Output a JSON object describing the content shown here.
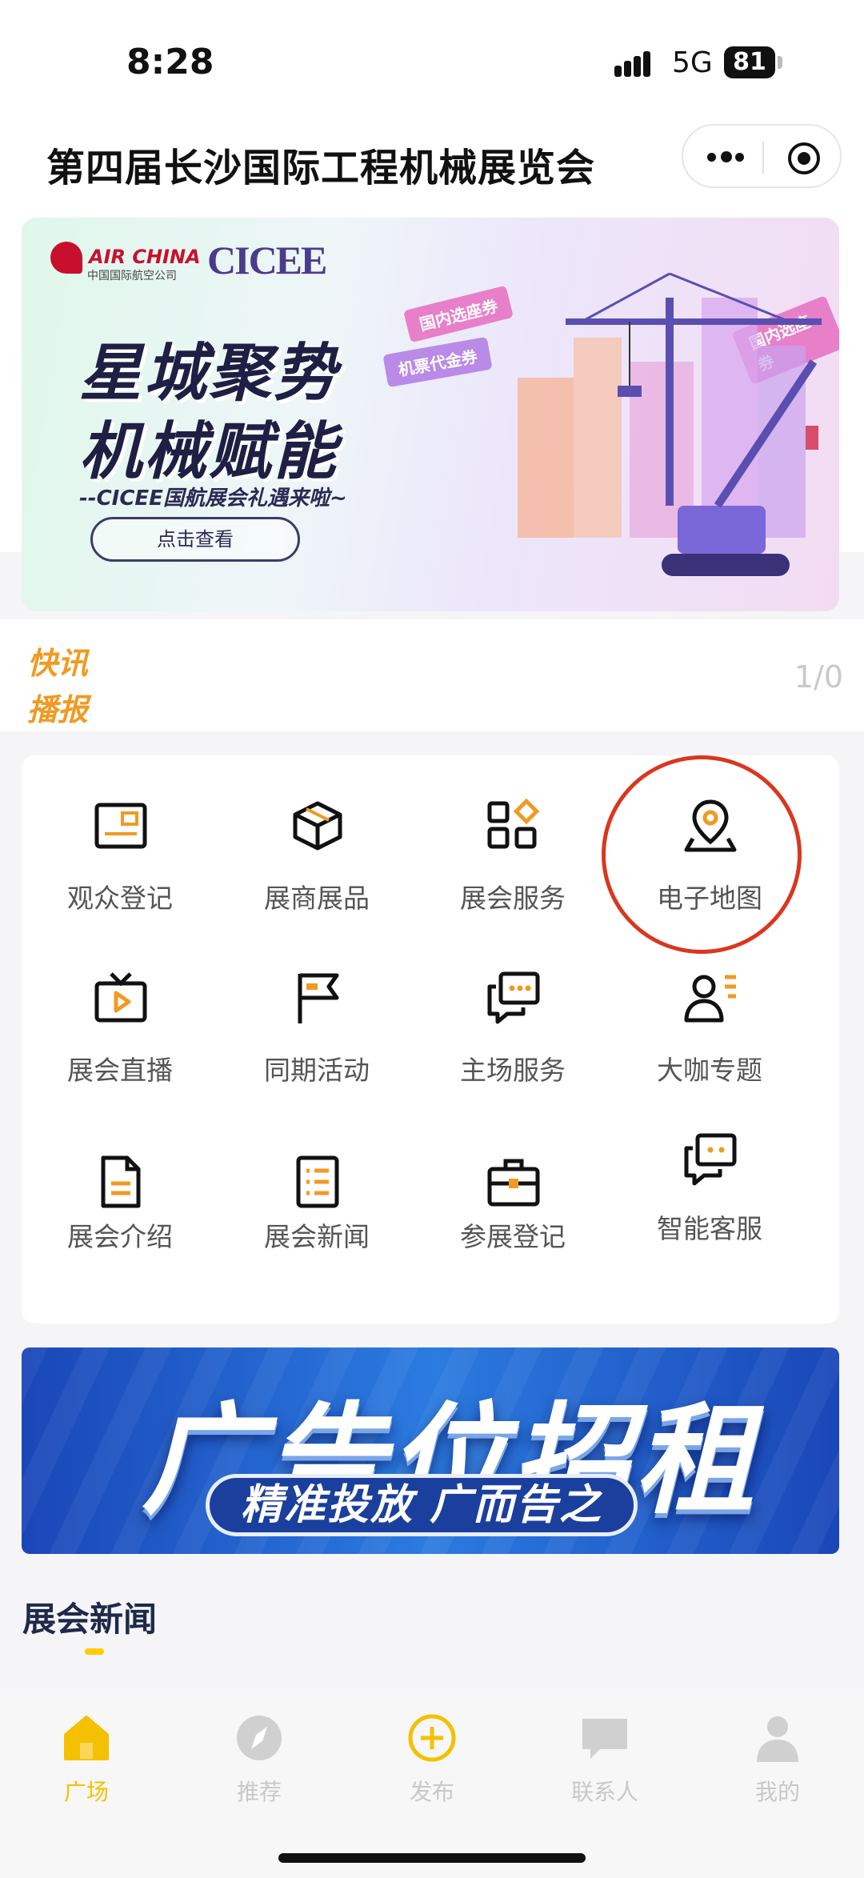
{
  "status_bar": {
    "time": "8:28",
    "network": "5G",
    "battery": "81"
  },
  "nav": {
    "title": "第四届长沙国际工程机械展览会"
  },
  "banner": {
    "logo_air": "AIR CHINA",
    "logo_air_cn": "中国国际航空公司",
    "logo_cicee": "CICEE",
    "headline_1": "星城聚势",
    "headline_2": "机械赋能",
    "subline": "--CICEE国航展会礼遇来啦~",
    "button_label": "点击查看",
    "ribbons": [
      "国内选座券",
      "机票代金券",
      "国内选座券"
    ]
  },
  "ticker": {
    "label_line1": "快讯",
    "label_line2": "播报",
    "page": "1/0"
  },
  "grid": [
    {
      "label": "观众登记",
      "icon": "id-card-icon"
    },
    {
      "label": "展商展品",
      "icon": "box-icon"
    },
    {
      "label": "展会服务",
      "icon": "apps-icon"
    },
    {
      "label": "电子地图",
      "icon": "map-pin-icon"
    },
    {
      "label": "展会直播",
      "icon": "tv-play-icon"
    },
    {
      "label": "同期活动",
      "icon": "flag-icon"
    },
    {
      "label": "主场服务",
      "icon": "chat-bubbles-icon"
    },
    {
      "label": "大咖专题",
      "icon": "user-list-icon"
    },
    {
      "label": "展会介绍",
      "icon": "document-icon"
    },
    {
      "label": "展会新闻",
      "icon": "news-list-icon"
    },
    {
      "label": "参展登记",
      "icon": "briefcase-icon"
    },
    {
      "label": "智能客服",
      "icon": "service-chat-icon"
    }
  ],
  "ad": {
    "main": "广告位招租",
    "sub": "精准投放 广而告之"
  },
  "section": {
    "title": "展会新闻"
  },
  "tabbar": [
    {
      "label": "广场",
      "icon": "home-icon",
      "active": true
    },
    {
      "label": "推荐",
      "icon": "compass-icon",
      "active": false
    },
    {
      "label": "发布",
      "icon": "plus-circle-icon",
      "active": false
    },
    {
      "label": "联系人",
      "icon": "message-icon",
      "active": false
    },
    {
      "label": "我的",
      "icon": "person-icon",
      "active": false
    }
  ],
  "colors": {
    "accent": "#f5c000",
    "orange": "#f09a22",
    "highlight": "#d9371e",
    "ad_blue": "#1a47b8"
  }
}
